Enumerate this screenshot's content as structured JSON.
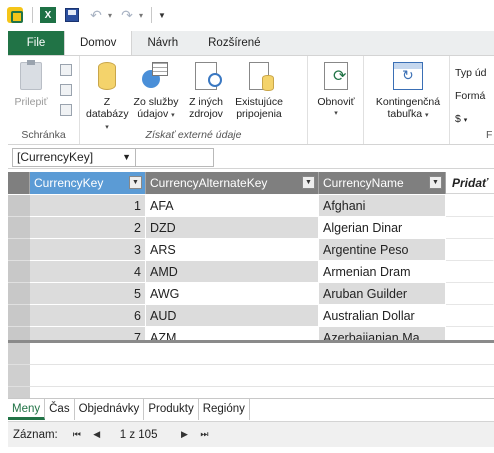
{
  "qat": {
    "icons": [
      "powerpivot-icon",
      "excel-icon",
      "save-icon",
      "undo-icon",
      "redo-icon",
      "customize-icon"
    ],
    "excel_letter": "X"
  },
  "ribbon_tabs": [
    {
      "label": "File"
    },
    {
      "label": "Domov"
    },
    {
      "label": "Návrh"
    },
    {
      "label": "Rozšírené"
    }
  ],
  "ribbon": {
    "paste_label": "Prilepiť",
    "clipboard_group": "Schránka",
    "from_db_line1": "Z",
    "from_db_line2": "databázy",
    "from_services_line1": "Zo služby",
    "from_services_line2": "údajov",
    "from_other_line1": "Z iných",
    "from_other_line2": "zdrojov",
    "existing_line1": "Existujúce",
    "existing_line2": "pripojenia",
    "external_group": "Získať externé údaje",
    "refresh_label": "Obnoviť",
    "pivot_line1": "Kontingenčná",
    "pivot_line2": "tabuľka",
    "right_type": "Typ úd",
    "right_format": "Formá",
    "right_currency": "$",
    "right_group": "F"
  },
  "formula_bar": {
    "name_box": "[CurrencyKey]"
  },
  "table": {
    "columns": [
      "CurrencyKey",
      "CurrencyAlternateKey",
      "CurrencyName"
    ],
    "add_column": "Pridať",
    "rows": [
      {
        "key": "1",
        "alt": "AFA",
        "name": "Afghani"
      },
      {
        "key": "2",
        "alt": "DZD",
        "name": "Algerian Dinar"
      },
      {
        "key": "3",
        "alt": "ARS",
        "name": "Argentine Peso"
      },
      {
        "key": "4",
        "alt": "AMD",
        "name": "Armenian Dram"
      },
      {
        "key": "5",
        "alt": "AWG",
        "name": "Aruban Guilder"
      },
      {
        "key": "6",
        "alt": "AUD",
        "name": "Australian Dollar"
      },
      {
        "key": "7",
        "alt": "AZM",
        "name": "Azerbaijanian Ma"
      }
    ]
  },
  "sheets": [
    "Meny",
    "Čas",
    "Objednávky",
    "Produkty",
    "Regióny"
  ],
  "status": {
    "record_label": "Záznam:",
    "position": "1 z 105",
    "first": "⏮",
    "prev": "◀",
    "next": "▶",
    "last": "⏭"
  }
}
